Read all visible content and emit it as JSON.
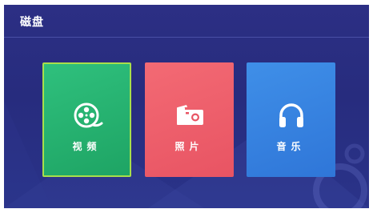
{
  "header": {
    "title": "磁盘"
  },
  "tiles": [
    {
      "label": "视频",
      "icon": "film-reel-icon",
      "color": "#22ad6d",
      "selected": true
    },
    {
      "label": "照片",
      "icon": "photo-icon",
      "color": "#ee5f6c",
      "selected": false
    },
    {
      "label": "音乐",
      "icon": "headphones-icon",
      "color": "#3783e0",
      "selected": false
    }
  ],
  "colors": {
    "background": "#2a2f84",
    "selected_border": "#a8df4a"
  }
}
